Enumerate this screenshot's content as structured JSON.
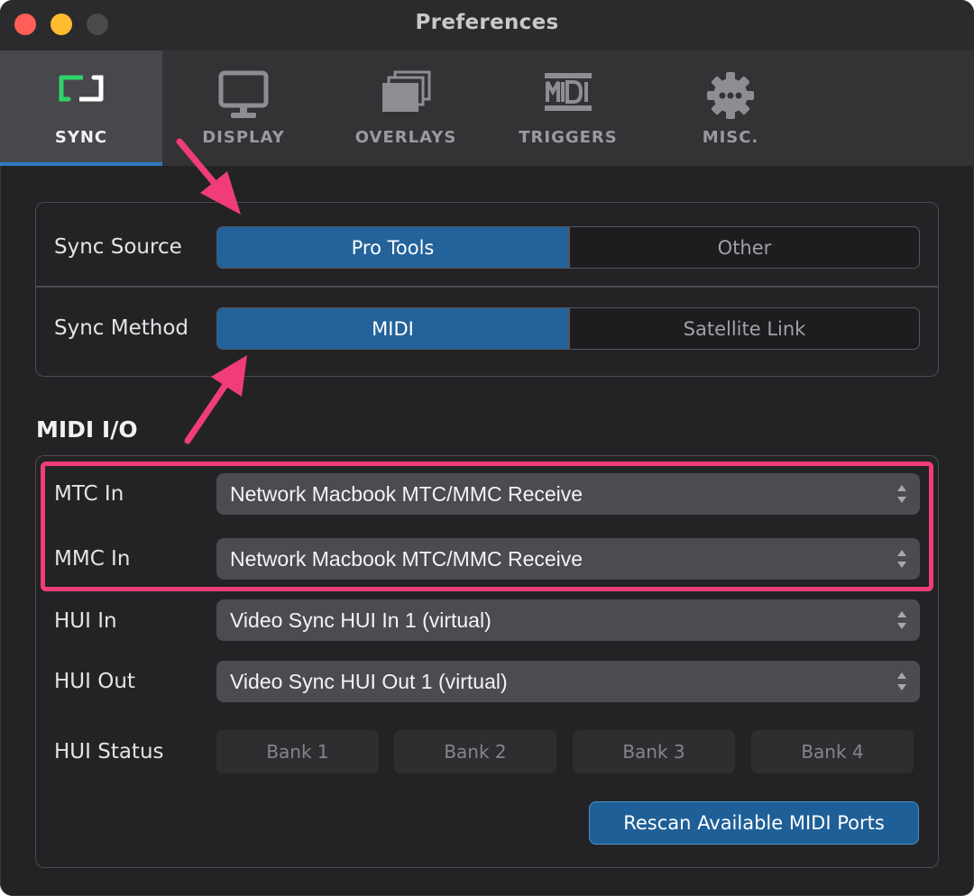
{
  "window": {
    "title": "Preferences"
  },
  "tabs": [
    {
      "label": "SYNC",
      "icon": "sync-icon",
      "active": true
    },
    {
      "label": "DISPLAY",
      "icon": "monitor-icon",
      "active": false
    },
    {
      "label": "OVERLAYS",
      "icon": "overlays-icon",
      "active": false
    },
    {
      "label": "TRIGGERS",
      "icon": "midi-icon",
      "active": false
    },
    {
      "label": "MISC.",
      "icon": "gear-icon",
      "active": false
    }
  ],
  "sync": {
    "source_label": "Sync Source",
    "source_options": [
      "Pro Tools",
      "Other"
    ],
    "source_selected": "Pro Tools",
    "method_label": "Sync Method",
    "method_options": [
      "MIDI",
      "Satellite Link"
    ],
    "method_selected": "MIDI"
  },
  "midi_io": {
    "title": "MIDI I/O",
    "mtc_in": {
      "label": "MTC In",
      "value": "Network Macbook MTC/MMC Receive"
    },
    "mmc_in": {
      "label": "MMC In",
      "value": "Network Macbook MTC/MMC Receive"
    },
    "hui_in": {
      "label": "HUI In",
      "value": "Video Sync HUI In 1 (virtual)"
    },
    "hui_out": {
      "label": "HUI Out",
      "value": "Video Sync HUI Out 1 (virtual)"
    },
    "hui_status": {
      "label": "HUI Status",
      "banks": [
        "Bank 1",
        "Bank 2",
        "Bank 3",
        "Bank 4"
      ]
    },
    "rescan_label": "Rescan Available MIDI Ports"
  },
  "colors": {
    "accent": "#23629a",
    "annotation": "#f03d77"
  }
}
